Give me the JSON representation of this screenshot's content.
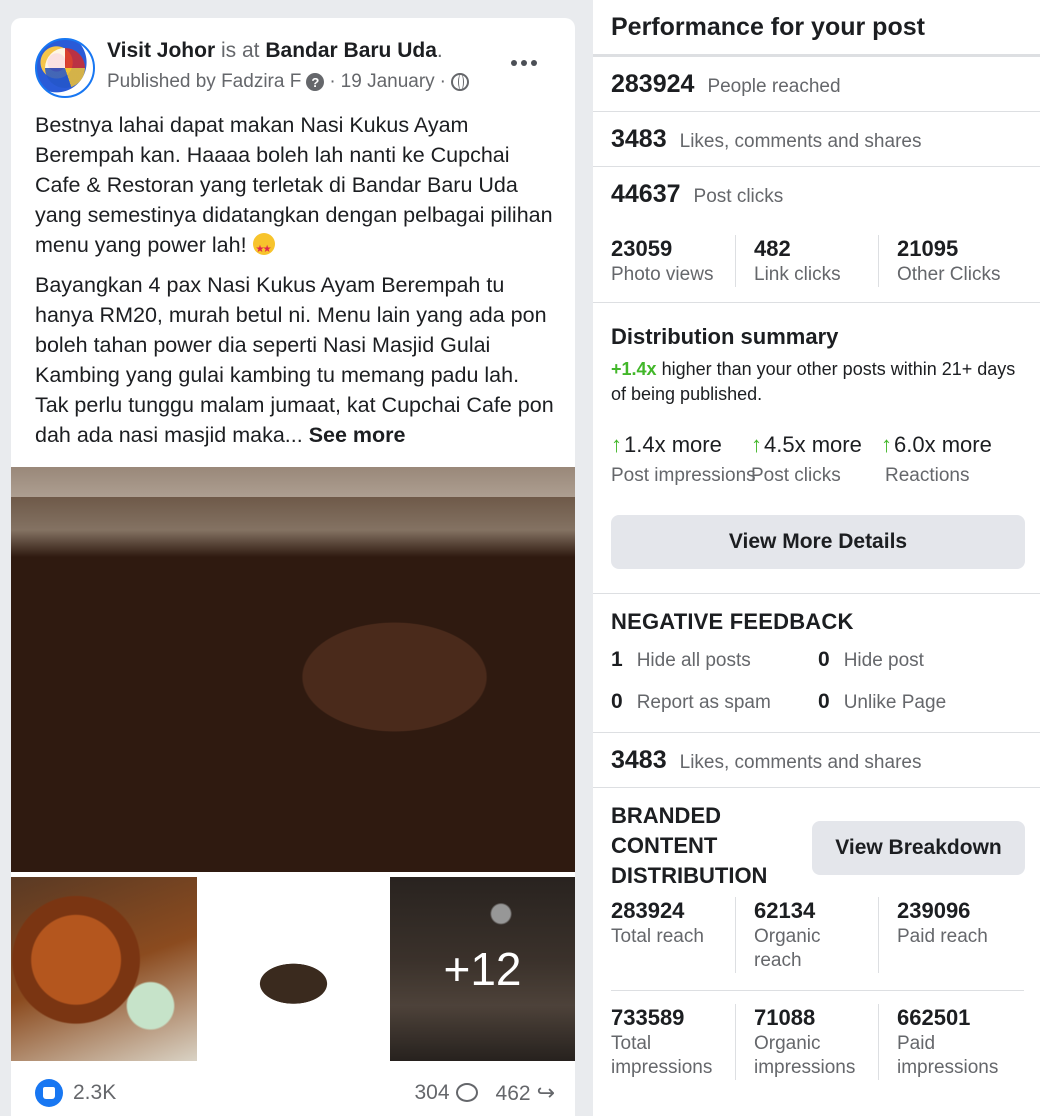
{
  "post": {
    "page_name": "Visit Johor",
    "is_at": "is at",
    "location": "Bandar Baru Uda",
    "published_by": "Published by Fadzira F",
    "date": "19 January",
    "paragraph_1": "Bestnya lahai dapat makan Nasi Kukus Ayam Berempah kan. Haaaa boleh lah nanti ke Cupchai Cafe & Restoran yang terletak di Bandar Baru Uda yang semestinya didatangkan dengan pelbagai pilihan menu yang power lah!",
    "paragraph_2": "Bayangkan 4 pax Nasi Kukus Ayam Berempah tu hanya RM20, murah betul ni. Menu lain yang ada pon boleh tahan power dia seperti Nasi Masjid Gulai Kambing yang gulai kambing tu memang padu lah. Tak perlu tunggu malam jumaat, kat Cupchai Cafe pon dah ada nasi masjid maka...",
    "see_more": "See more",
    "extra_photos": "+12",
    "reactions": "2.3K",
    "comments": "304",
    "shares": "462",
    "icons": {
      "more": "more-dots-icon",
      "help": "question-icon",
      "privacy": "globe-icon",
      "emoji": "star-struck-emoji",
      "like": "like-icon",
      "comment": "comment-icon",
      "share": "share-icon"
    }
  },
  "panel": {
    "title": "Performance for your post",
    "people_reached": {
      "value": "283924",
      "label": "People reached"
    },
    "engagement": {
      "value": "3483",
      "label": "Likes, comments and shares"
    },
    "post_clicks": {
      "value": "44637",
      "label": "Post clicks"
    },
    "click_breakdown": [
      {
        "value": "23059",
        "label": "Photo views"
      },
      {
        "value": "482",
        "label": "Link clicks"
      },
      {
        "value": "21095",
        "label": "Other Clicks"
      }
    ],
    "distribution": {
      "title": "Distribution summary",
      "highlight": "+1.4x",
      "text": "higher than your other posts within 21+ days of being published.",
      "multipliers": [
        {
          "value": "1.4x more",
          "label": "Post impressions"
        },
        {
          "value": "4.5x more",
          "label": "Post clicks"
        },
        {
          "value": "6.0x more",
          "label": "Reactions"
        }
      ],
      "button": "View More Details"
    },
    "negative_feedback": {
      "title": "NEGATIVE FEEDBACK",
      "items": [
        {
          "value": "1",
          "label": "Hide all posts"
        },
        {
          "value": "0",
          "label": "Hide post"
        },
        {
          "value": "0",
          "label": "Report as spam"
        },
        {
          "value": "0",
          "label": "Unlike Page"
        }
      ]
    },
    "engagement_2": {
      "value": "3483",
      "label": "Likes, comments and shares"
    },
    "branded": {
      "title": "BRANDED CONTENT DISTRIBUTION",
      "button": "View Breakdown",
      "reach": [
        {
          "value": "283924",
          "label": "Total reach"
        },
        {
          "value": "62134",
          "label": "Organic reach"
        },
        {
          "value": "239096",
          "label": "Paid reach"
        }
      ],
      "impressions": [
        {
          "value": "733589",
          "label": "Total impressions"
        },
        {
          "value": "71088",
          "label": "Organic impressions"
        },
        {
          "value": "662501",
          "label": "Paid impressions"
        }
      ]
    },
    "colors": {
      "positive": "#42b72a",
      "brand": "#1877f2"
    }
  }
}
